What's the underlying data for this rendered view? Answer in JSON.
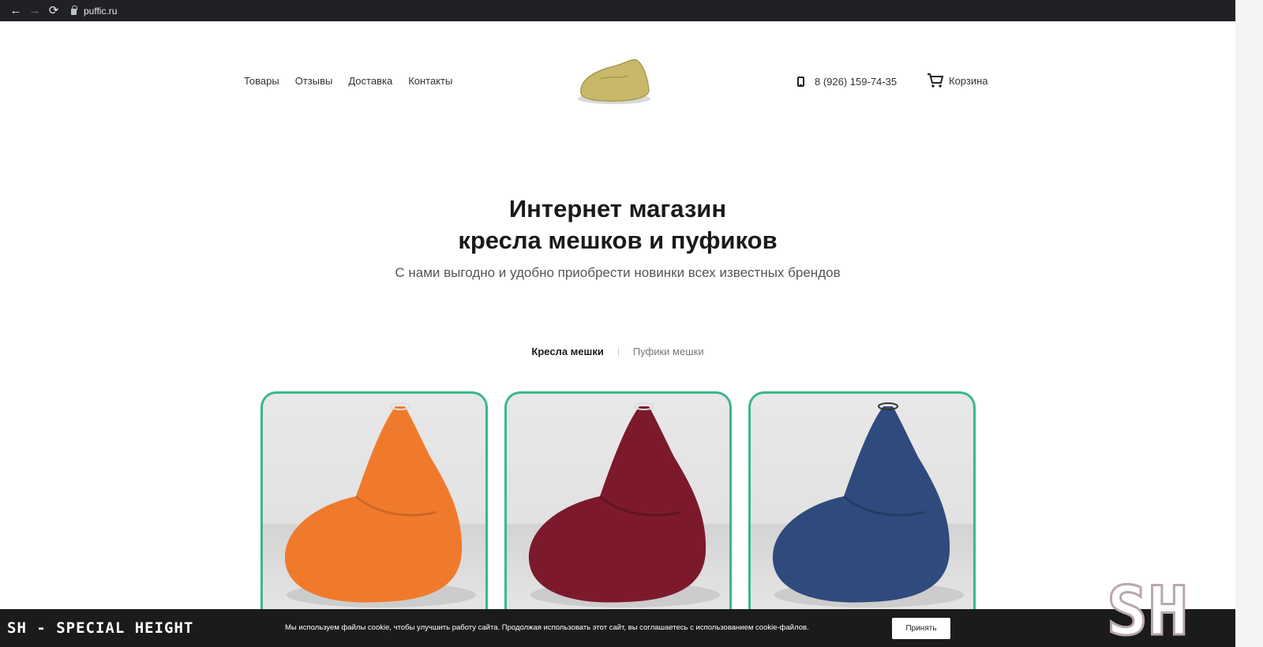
{
  "browser": {
    "back_icon": "←",
    "forward_icon": "→",
    "reload_icon": "⟳",
    "url": "puffic.ru"
  },
  "header": {
    "nav": [
      "Товары",
      "Отзывы",
      "Доставка",
      "Контакты"
    ],
    "phone": "8 (926) 159-74-35",
    "cart_label": "Корзина"
  },
  "hero": {
    "title_line1": "Интернет магазин",
    "title_line2": "кресла мешков и пуфиков",
    "subtitle": "С нами выгодно и удобно приобрести новинки всех известных брендов"
  },
  "tabs": {
    "active": "Кресла мешки",
    "other": "Пуфики мешки"
  },
  "products": [
    {
      "color": "#f07a2c"
    },
    {
      "color": "#7c1a2b"
    },
    {
      "color": "#2f4a7c"
    }
  ],
  "cookie": {
    "brand": "SH - SPECIAL HEIGHT",
    "text": "Мы используем файлы cookie, чтобы улучшить работу сайта. Продолжая использовать этот сайт, вы соглашаетесь с использованием cookie-файлов.",
    "accept": "Принять"
  },
  "watermark": "SH",
  "colors": {
    "accent": "#3ab887",
    "logo": "#c8b86a"
  }
}
